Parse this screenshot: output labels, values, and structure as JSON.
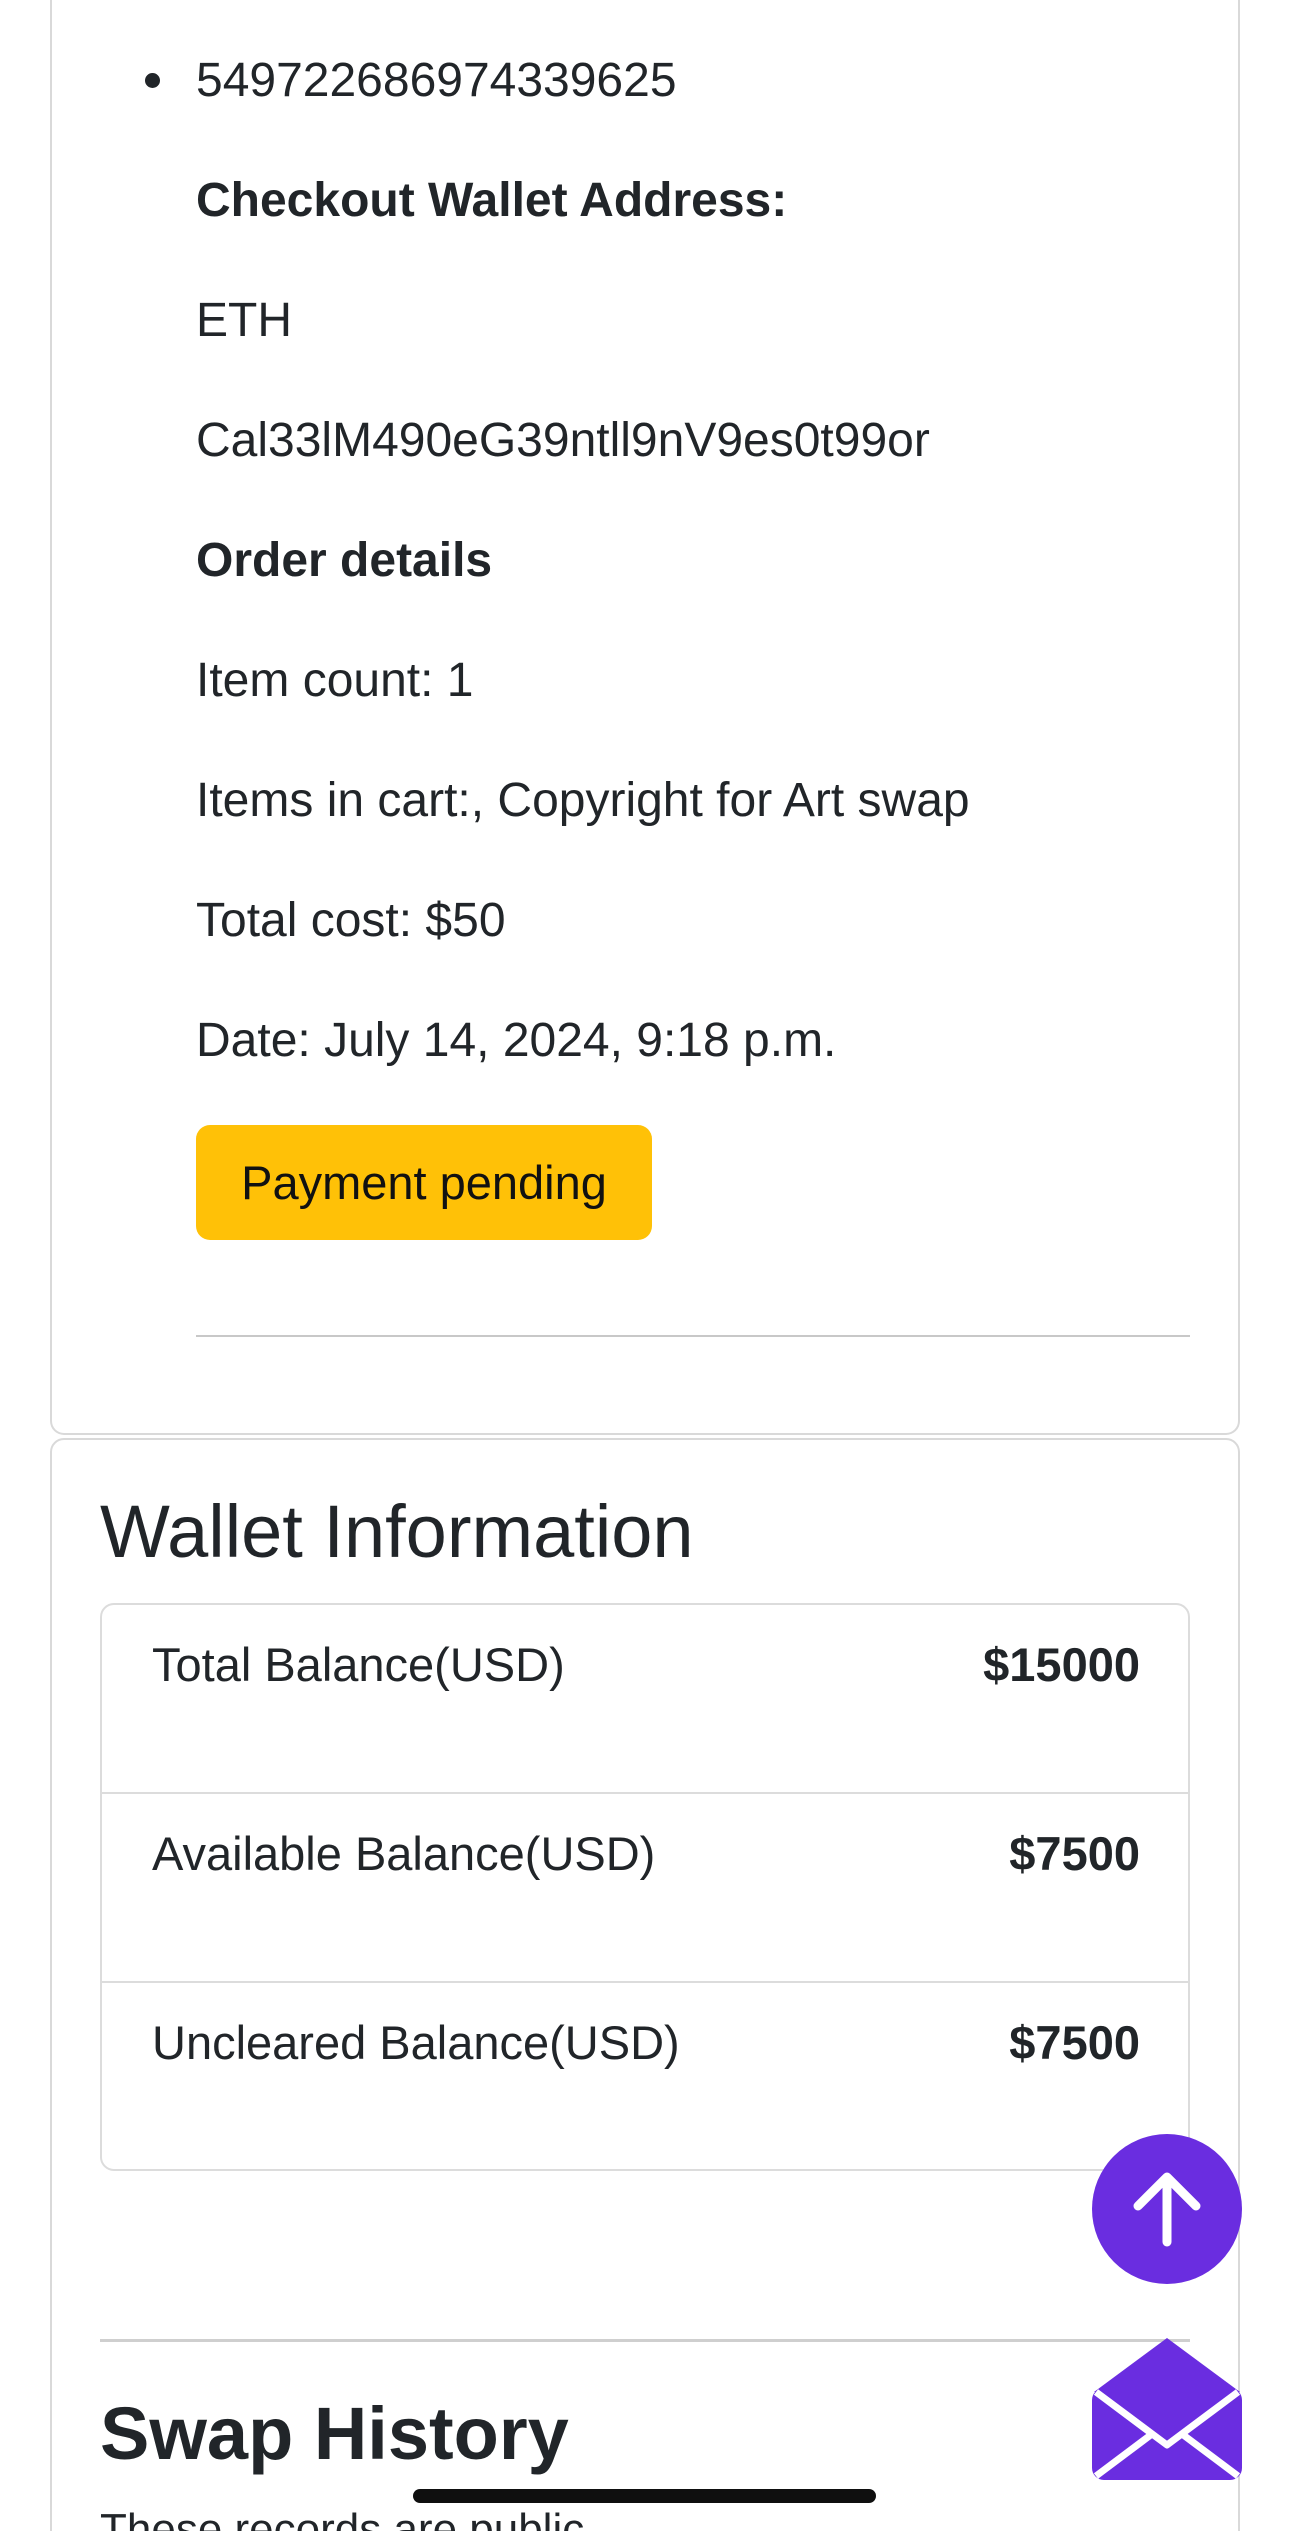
{
  "order": {
    "order_id": "549722686974339625",
    "checkout_wallet_heading": "Checkout Wallet Address:",
    "currency": "ETH",
    "wallet_address": "Cal33lM490eG39ntll9nV9es0t99or",
    "order_details_heading": "Order details",
    "item_count": "Item count: 1",
    "items_in_cart": "Items in cart:, Copyright for Art swap",
    "total_cost": "Total cost: $50",
    "date": "Date: July 14, 2024, 9:18 p.m.",
    "status": "Payment pending"
  },
  "wallet": {
    "title": "Wallet Information",
    "rows": [
      {
        "label": "Total Balance(USD)",
        "value": "$15000"
      },
      {
        "label": "Available Balance(USD)",
        "value": "$7500"
      },
      {
        "label": "Uncleared Balance(USD)",
        "value": "$7500"
      }
    ]
  },
  "swap": {
    "title": "Swap History",
    "note": "These records are public"
  },
  "icons": {
    "scroll_top": "arrow-up-icon",
    "messages": "envelope-icon"
  },
  "colors": {
    "status_pending": "#ffc107",
    "accent": "#6a2de0",
    "text": "#212529"
  }
}
